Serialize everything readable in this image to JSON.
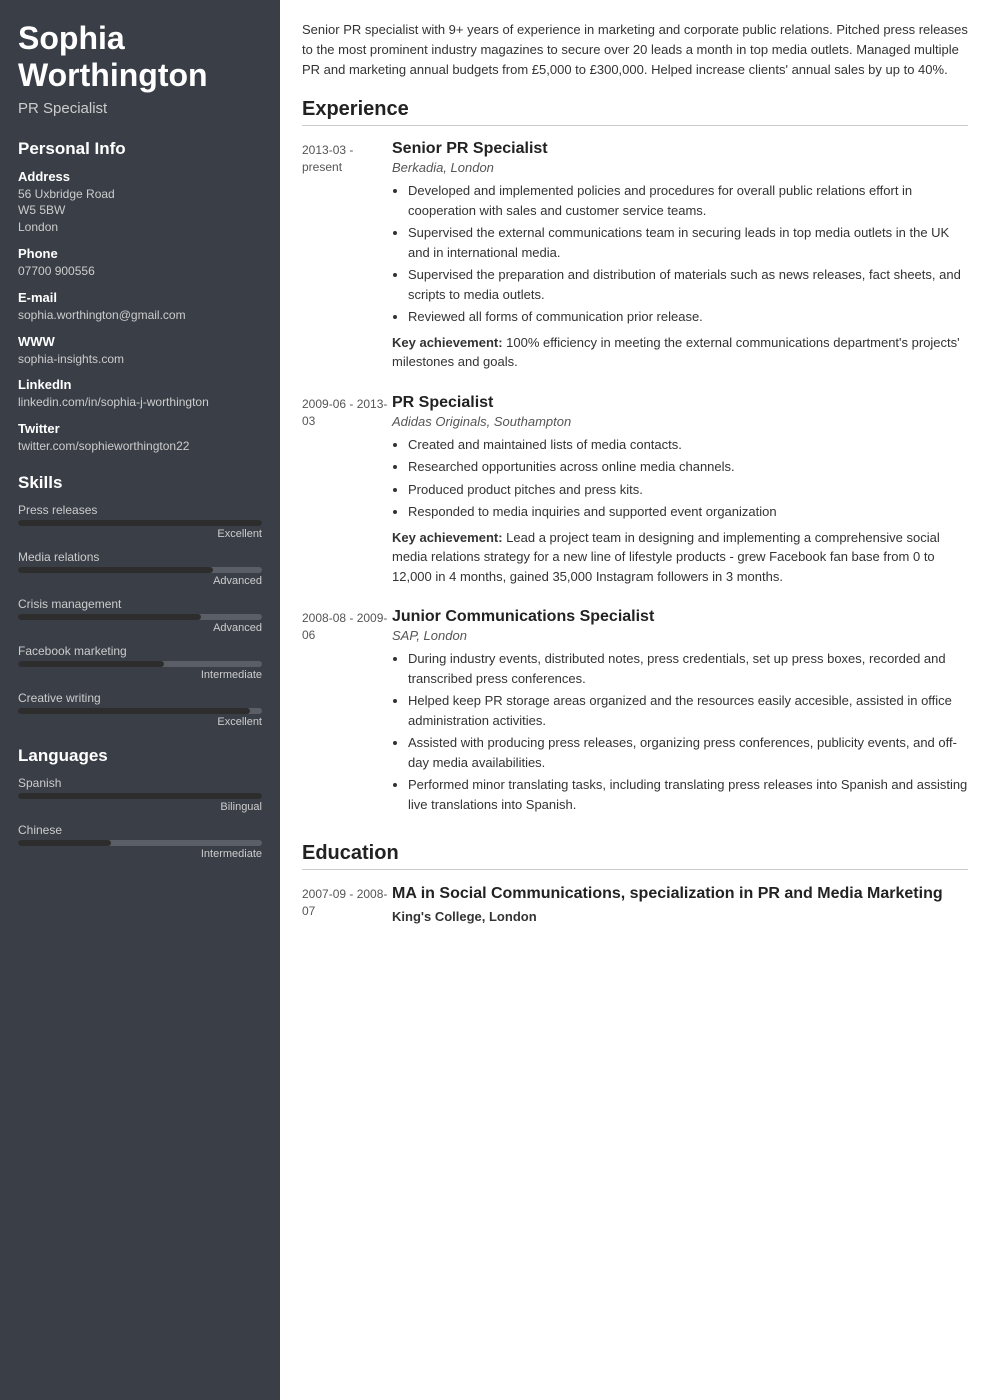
{
  "sidebar": {
    "name": "Sophia Worthington",
    "title": "PR Specialist",
    "personal_info_label": "Personal Info",
    "address_label": "Address",
    "address_lines": [
      "56 Uxbridge Road",
      "W5 5BW",
      "London"
    ],
    "phone_label": "Phone",
    "phone": "07700 900556",
    "email_label": "E-mail",
    "email": "sophia.worthington@gmail.com",
    "www_label": "WWW",
    "www": "sophia-insights.com",
    "linkedin_label": "LinkedIn",
    "linkedin": "linkedin.com/in/sophia-j-worthington",
    "twitter_label": "Twitter",
    "twitter": "twitter.com/sophieworthington22",
    "skills_label": "Skills",
    "skills": [
      {
        "name": "Press releases",
        "level": "Excellent",
        "pct": 100
      },
      {
        "name": "Media relations",
        "level": "Advanced",
        "pct": 80
      },
      {
        "name": "Crisis management",
        "level": "Advanced",
        "pct": 75
      },
      {
        "name": "Facebook marketing",
        "level": "Intermediate",
        "pct": 60
      },
      {
        "name": "Creative writing",
        "level": "Excellent",
        "pct": 95
      }
    ],
    "languages_label": "Languages",
    "languages": [
      {
        "name": "Spanish",
        "level": "Bilingual",
        "pct": 100
      },
      {
        "name": "Chinese",
        "level": "Intermediate",
        "pct": 38
      }
    ]
  },
  "main": {
    "summary": "Senior PR specialist with 9+ years of experience in marketing and corporate public relations. Pitched press releases to the most prominent industry magazines to secure over 20 leads a month in top media outlets. Managed multiple PR and marketing annual budgets from £5,000 to £300,000. Helped increase clients' annual sales by up to 40%.",
    "experience_label": "Experience",
    "experience": [
      {
        "date": "2013-03 - present",
        "job_title": "Senior PR Specialist",
        "company": "Berkadia, London",
        "bullets": [
          "Developed and implemented policies and procedures for overall public relations effort in cooperation with sales and customer service teams.",
          "Supervised the external communications team in securing leads in top media outlets in the UK and in international media.",
          "Supervised the preparation and distribution of materials such as news releases, fact sheets, and scripts to media outlets.",
          "Reviewed all forms of communication prior release."
        ],
        "achievement": "Key achievement: 100% efficiency in meeting the external communications department's projects' milestones and goals."
      },
      {
        "date": "2009-06 - 2013-03",
        "job_title": "PR Specialist",
        "company": "Adidas Originals, Southampton",
        "bullets": [
          "Created and maintained lists of media contacts.",
          "Researched opportunities across online media channels.",
          "Produced product pitches and press kits.",
          "Responded to media inquiries and supported event organization"
        ],
        "achievement": "Key achievement: Lead a project team in designing and implementing a comprehensive social media relations strategy for a new line of lifestyle products - grew Facebook fan base from 0 to 12,000 in 4 months, gained 35,000 Instagram followers in 3 months."
      },
      {
        "date": "2008-08 - 2009-06",
        "job_title": "Junior Communications Specialist",
        "company": "SAP, London",
        "bullets": [
          "During industry events, distributed notes, press credentials, set up press boxes, recorded and transcribed press conferences.",
          "Helped keep PR storage areas organized and the resources easily accesible, assisted in office administration activities.",
          "Assisted with producing press releases, organizing press conferences, publicity events, and off-day media availabilities.",
          "Performed minor translating tasks, including translating press releases into Spanish and assisting live translations into Spanish."
        ],
        "achievement": ""
      }
    ],
    "education_label": "Education",
    "education": [
      {
        "date": "2007-09 - 2008-07",
        "degree": "MA in Social Communications, specialization in PR and Media Marketing",
        "school": "King's College, London"
      }
    ]
  }
}
